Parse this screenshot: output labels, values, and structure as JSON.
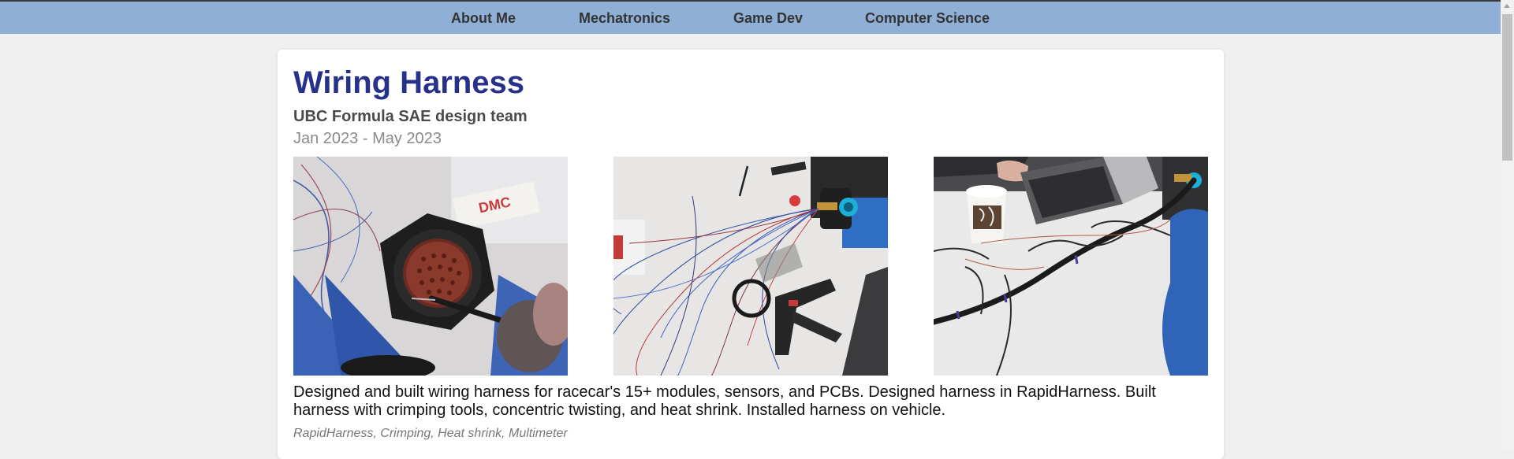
{
  "nav": {
    "items": [
      {
        "label": "About Me"
      },
      {
        "label": "Mechatronics"
      },
      {
        "label": "Game Dev"
      },
      {
        "label": "Computer Science"
      }
    ]
  },
  "project": {
    "title": "Wiring Harness",
    "subtitle": "UBC Formula SAE design team",
    "dates": "Jan 2023 - May 2023",
    "description": "Designed and built wiring harness for racecar's 15+ modules, sensors, and PCBs. Designed harness in RapidHarness. Built harness with crimping tools, concentric twisting, and heat shrink. Installed harness on vehicle.",
    "tags": "RapidHarness, Crimping, Heat shrink, Multimeter"
  },
  "colors": {
    "navbar": "#8fafd7",
    "title": "#27318a",
    "background": "#efefef"
  }
}
